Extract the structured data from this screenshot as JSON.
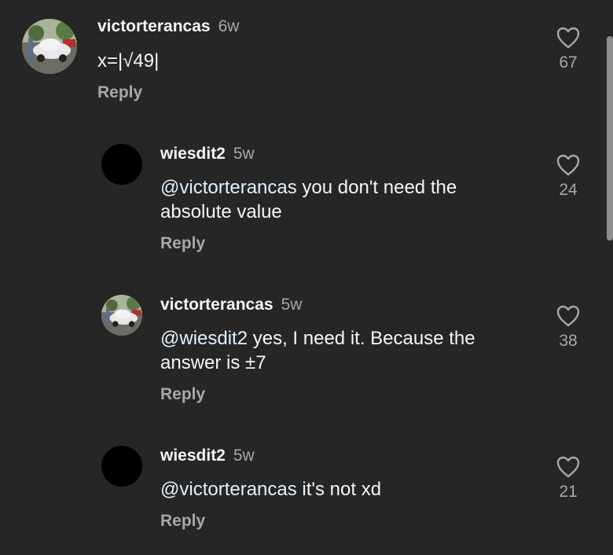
{
  "comments": [
    {
      "username": "victorterancas",
      "time": "6w",
      "mention": "",
      "text": "x=|√49|",
      "reply_label": "Reply",
      "likes": "67",
      "avatar": "car-photo"
    },
    {
      "username": "wiesdit2",
      "time": "5w",
      "mention": "@victorterancas",
      "text": " you don't need the absolute value",
      "reply_label": "Reply",
      "likes": "24",
      "avatar": "black"
    },
    {
      "username": "victorterancas",
      "time": "5w",
      "mention": "@wiesdit2",
      "text": " yes, I need it. Because the answer is ±7",
      "reply_label": "Reply",
      "likes": "38",
      "avatar": "car-photo"
    },
    {
      "username": "wiesdit2",
      "time": "5w",
      "mention": "@victorterancas",
      "text": " it's not xd",
      "reply_label": "Reply",
      "likes": "21",
      "avatar": "black"
    }
  ],
  "icons": {
    "like": "heart-outline-icon"
  },
  "colors": {
    "background": "#262626",
    "text": "#f5f5f5",
    "secondary": "#a8a8a8",
    "mention": "#e0f1ff"
  }
}
